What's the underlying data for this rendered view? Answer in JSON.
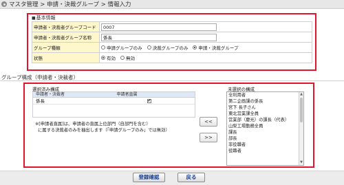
{
  "breadcrumb": {
    "icon": "gear-icon",
    "text": "マスタ管理 > 申請・決裁グループ > 情報入力"
  },
  "basic_info": {
    "title": "基本情報",
    "rows": {
      "code": {
        "label": "申請者・決裁者グループコード",
        "value": "0007"
      },
      "name": {
        "label": "申請者・決裁者グループ名称",
        "value": "係長"
      },
      "kind": {
        "label": "グループ種類",
        "options": [
          "申請グループのみ",
          "決裁グループのみ",
          "申請・決裁グループ"
        ],
        "selected": "申請・決裁グループ"
      },
      "status": {
        "label": "状態",
        "options": [
          "有効",
          "無効"
        ],
        "selected": "有効"
      }
    }
  },
  "group_section": {
    "title": "グループ構成（申請者・決裁者）",
    "selected_label": "選択済み構成",
    "unselected_label": "未選択の構成",
    "table_headers": [
      "申請者・決裁者",
      "申請者直属"
    ],
    "selected_rows": [
      {
        "name": "係長",
        "direct": true
      }
    ],
    "note_line1": "※[申請者直属]は、申請者の直属上位部門（自部門を含む）",
    "note_line2": "に属する決裁者のみを抽出します（「申請グループのみ」では無効）",
    "move_left_label": "<<",
    "move_right_label": ">>",
    "unselected_items": [
      "全利用者",
      "第二企画課の係長",
      "宮下 長子さん",
      "東北営業課全員",
      "営業部（慶光）の課長（代表）",
      "山梨工場勤務全員",
      "課長",
      "部長",
      "非役職者",
      "役職者"
    ]
  },
  "footer": {
    "confirm_label": "登録確認",
    "back_label": "戻る"
  }
}
